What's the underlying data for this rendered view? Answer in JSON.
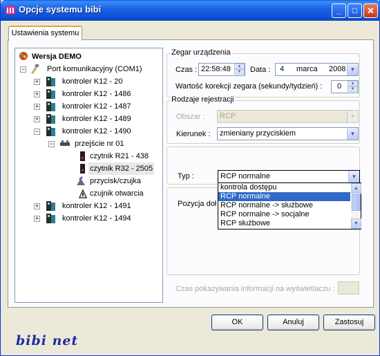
{
  "window": {
    "title": "Opcje systemu bibi",
    "minimize_label": "_",
    "maximize_label": "□",
    "close_label": "✕"
  },
  "tabs": [
    {
      "label": "Ustawienia systemu"
    }
  ],
  "tree": {
    "root_label": "Wersja DEMO",
    "port_label": "Port komunikacyjny (COM1)",
    "controllers": [
      {
        "label": "kontroler K12 - 20"
      },
      {
        "label": "kontroler K12 - 1486"
      },
      {
        "label": "kontroler K12 - 1487"
      },
      {
        "label": "kontroler K12 - 1489"
      },
      {
        "label": "kontroler K12 - 1490"
      },
      {
        "label": "kontroler K12 - 1491"
      },
      {
        "label": "kontroler K12 - 1494"
      }
    ],
    "passage_label": "przejście nr 01",
    "passage_children": [
      {
        "label": "czytnik R21 - 438"
      },
      {
        "label": "czytnik R32 - 2505"
      },
      {
        "label": "przycisk/czujka"
      },
      {
        "label": "czujnik otwarcia"
      }
    ]
  },
  "clock": {
    "legend": "Zegar urządzenia",
    "time_label": "Czas :",
    "time_value": "22:58:48",
    "date_label": "Data :",
    "date_day": "4",
    "date_month": "marca",
    "date_year": "2008",
    "correction_label": "Wartość korekcji zegara (sekundy/tydzień) :",
    "correction_value": "0"
  },
  "registration": {
    "legend": "Rodzaje rejestracji",
    "area_label": "Obszar :",
    "area_value": "RCP",
    "direction_label": "Kierunek :",
    "direction_value": "zmieniany przyciskiem"
  },
  "type": {
    "label": "Typ :",
    "value": "RCP normalne",
    "options": [
      {
        "label": "kontrola dostępu",
        "selected": false
      },
      {
        "label": "RCP normalne",
        "selected": true
      },
      {
        "label": "RCP normalne -> służbowe",
        "selected": false
      },
      {
        "label": "RCP normalne -> socjalne",
        "selected": false
      },
      {
        "label": "RCP służbowe",
        "selected": false
      }
    ]
  },
  "position_label": "Pozycja doł",
  "display_time_label": "Czas pokazywania informacji na wyświetlaczu :",
  "buttons": {
    "ok": "OK",
    "cancel": "Anuluj",
    "apply": "Zastosuj"
  },
  "logo_text": "bibi net",
  "colors": {
    "title_bar": "#0A5FE8",
    "selection": "#316AC5",
    "dialog_bg": "#ECE9D8"
  }
}
